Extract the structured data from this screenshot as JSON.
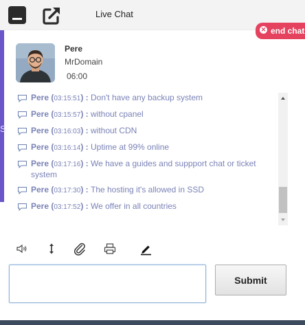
{
  "header": {
    "title": "Live Chat",
    "minimize_icon": "minimize-icon",
    "popout_icon": "popout-window-icon",
    "end_chat_label": "end chat",
    "end_chat_icon": "close-circle-icon"
  },
  "operator": {
    "name": "Pere",
    "company": "MrDomain",
    "time": "06:00"
  },
  "messages": [
    {
      "author": "Pere",
      "time": "03:15:51",
      "text": "Don't have any backup system"
    },
    {
      "author": "Pere",
      "time": "03:15:57",
      "text": "without cpanel"
    },
    {
      "author": "Pere",
      "time": "03:16:03",
      "text": "without CDN"
    },
    {
      "author": "Pere",
      "time": "03:16:14",
      "text": "Uptime at 99% online"
    },
    {
      "author": "Pere",
      "time": "03:17:16",
      "text": "We have a guides and suppport chat or ticket system"
    },
    {
      "author": "Pere",
      "time": "03:17:30",
      "text": "The hosting it's allowed in SSD"
    },
    {
      "author": "Pere",
      "time": "03:17:52",
      "text": "We offer in all countries"
    }
  ],
  "toolbar": {
    "icons": [
      "sound-icon",
      "resize-icon",
      "attachment-icon",
      "print-icon",
      "edit-pen-icon"
    ]
  },
  "input": {
    "value": "",
    "placeholder": ""
  },
  "submit_label": "Submit",
  "colors": {
    "message_text": "#7a82b6",
    "end_chat_bg": "#e5425f",
    "side_accent": "#6a55c9"
  },
  "background_glyph": "S"
}
